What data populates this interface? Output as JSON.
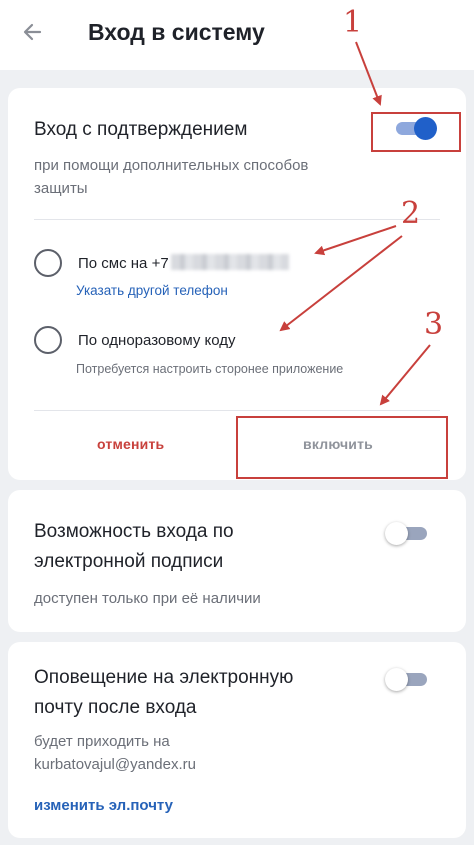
{
  "header": {
    "title": "Вход в систему",
    "back_icon": "arrow-left-icon"
  },
  "colors": {
    "accent": "#2060c9",
    "danger": "#c8413c",
    "link": "#2662b8",
    "annotation": "#c8403c"
  },
  "confirm_section": {
    "title": "Вход с подтверждением",
    "subtitle_line1": "при помощи дополнительных способов",
    "subtitle_line2": "защиты",
    "toggle_on": true,
    "options": [
      {
        "label": "По смс на +7",
        "link": "Указать другой телефон",
        "selected": false
      },
      {
        "label": "По одноразовому коду",
        "hint": "Потребуется настроить сторонее приложение",
        "selected": false
      }
    ],
    "cancel_label": "отменить",
    "enable_label": "включить"
  },
  "signature_section": {
    "title_line1": "Возможность входа по",
    "title_line2": "электронной подписи",
    "subtitle": "доступен только при её наличии",
    "toggle_on": false
  },
  "email_section": {
    "title_line1": "Оповещение на электронную",
    "title_line2": "почту после входа",
    "subtitle_line1": "будет приходить на",
    "subtitle_line2": "kurbatovajul@yandex.ru",
    "link": "изменить эл.почту",
    "toggle_on": false
  },
  "annotations": [
    "1",
    "2",
    "3"
  ]
}
